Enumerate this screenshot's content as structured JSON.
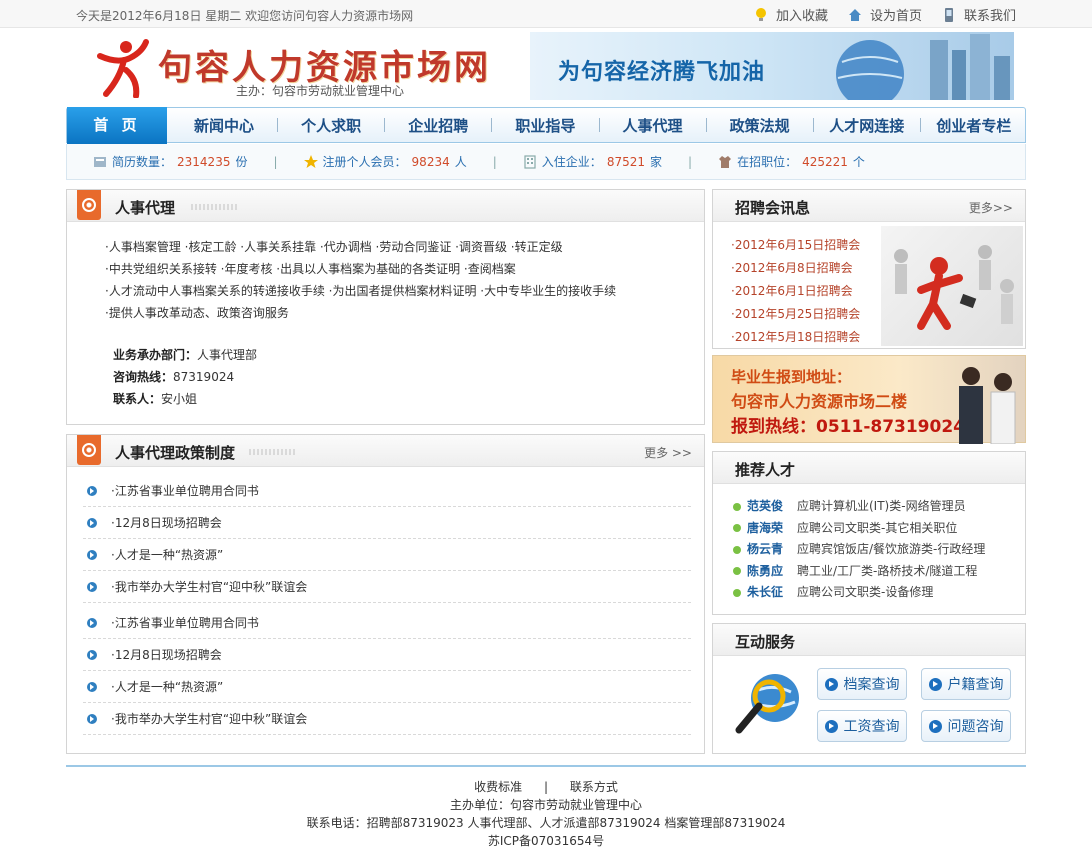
{
  "topbar": {
    "date_text": "今天是2012年6月18日 星期二   欢迎您访问句容人力资源市场网",
    "favorite": "加入收藏",
    "homepage": "设为首页",
    "contact": "联系我们"
  },
  "header": {
    "site_title": "句容人力资源市场网",
    "sponsor": "主办：句容市劳动就业管理中心",
    "banner_text": "为句容经济腾飞加油"
  },
  "nav": {
    "home": "首 页",
    "items": [
      "新闻中心",
      "个人求职",
      "企业招聘",
      "职业指导",
      "人事代理",
      "政策法规",
      "人才网连接",
      "创业者专栏"
    ]
  },
  "stats": {
    "resume_label": "简历数量：",
    "resume_value": "2314235",
    "resume_unit": "份",
    "member_label": "注册个人会员：",
    "member_value": "98234",
    "member_unit": "人",
    "company_label": "入住企业：",
    "company_value": "87521",
    "company_unit": "家",
    "job_label": "在招职位：",
    "job_value": "425221",
    "job_unit": "个"
  },
  "agency": {
    "title": "人事代理",
    "lines": [
      "·人事档案管理  ·核定工龄  ·人事关系挂靠  ·代办调档  ·劳动合同鉴证  ·调资晋级  ·转正定级",
      "·中共党组织关系接转  ·年度考核  ·出具以人事档案为基础的各类证明  ·查阅档案",
      "·人才流动中人事档案关系的转递接收手续  ·为出国者提供档案材料证明  ·大中专毕业生的接收手续",
      "·提供人事改革动态、政策咨询服务"
    ],
    "dept_label": "业务承办部门：",
    "dept_value": "人事代理部",
    "hotline_label": "咨询热线：",
    "hotline_value": "87319024",
    "contact_label": "联系人：",
    "contact_value": "安小姐"
  },
  "policy": {
    "title": "人事代理政策制度",
    "more": "更多 >>",
    "items": [
      "·江苏省事业单位聘用合同书",
      "·12月8日现场招聘会",
      "·人才是一种“热资源”",
      "·我市举办大学生村官“迎中秋”联谊会",
      "·江苏省事业单位聘用合同书",
      "·12月8日现场招聘会",
      "·人才是一种“热资源”",
      "·我市举办大学生村官“迎中秋”联谊会"
    ]
  },
  "jobfair": {
    "title": "招聘会讯息",
    "more": "更多>>",
    "items": [
      "·2012年6月15日招聘会",
      "·2012年6月8日招聘会",
      "·2012年6月1日招聘会",
      "·2012年5月25日招聘会",
      "·2012年5月18日招聘会"
    ]
  },
  "graduate": {
    "line1": "毕业生报到地址：",
    "line2": "句容市人力资源市场二楼",
    "line3": "报到热线：0511-87319024"
  },
  "talent": {
    "title": "推荐人才",
    "items": [
      {
        "name": "范英俊",
        "pos": "应聘计算机业(IT)类-网络管理员"
      },
      {
        "name": "唐海荣",
        "pos": "应聘公司文职类-其它相关职位"
      },
      {
        "name": "杨云青",
        "pos": "应聘宾馆饭店/餐饮旅游类-行政经理"
      },
      {
        "name": "陈勇应",
        "pos": "聘工业/工厂类-路桥技术/隧道工程"
      },
      {
        "name": "朱长征",
        "pos": "应聘公司文职类-设备修理"
      }
    ]
  },
  "service": {
    "title": "互动服务",
    "archive": "档案查询",
    "household": "户籍查询",
    "salary": "工资查询",
    "question": "问题咨询"
  },
  "footer": {
    "fees": "收费标准",
    "contact": "联系方式",
    "sponsor": "主办单位：句容市劳动就业管理中心",
    "phones": "联系电话：招聘部87319023  人事代理部、人才派遣部87319024  档案管理部87319024",
    "icp": "苏ICP备07031654号"
  }
}
